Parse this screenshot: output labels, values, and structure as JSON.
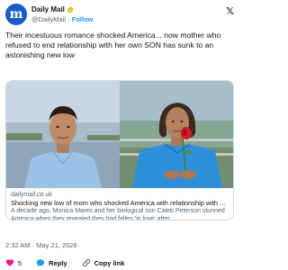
{
  "account": {
    "avatar_letter": "m",
    "name": "Daily Mail",
    "handle": "@DailyMail",
    "separator": "·",
    "follow_label": "Follow",
    "brand_color": "#1b5cc9"
  },
  "platform_logo": "𝕏",
  "tweet": {
    "text": "Their incestuous romance shocked America... now mother who refused to end relationship with her own SON has sunk to an astonishing new low"
  },
  "card": {
    "domain": "dailymail.co.uk",
    "title": "Shocking new low of mom who shocked America with relationship with ...",
    "description": "A decade ago, Monica Mares and her biological son Caleb Peterson stunned America when they revealed they had fallen 'in love' after ..."
  },
  "timestamp": "2:32 AM · May 21, 2026",
  "actions": {
    "like_count": "5",
    "reply_label": "Reply",
    "copy_label": "Copy link"
  },
  "icons": [
    "verified-badge-icon",
    "x-logo-icon",
    "heart-icon",
    "reply-icon",
    "link-icon"
  ],
  "colors": {
    "accent": "#1d9bf0",
    "like": "#f91880",
    "muted": "#536471"
  }
}
